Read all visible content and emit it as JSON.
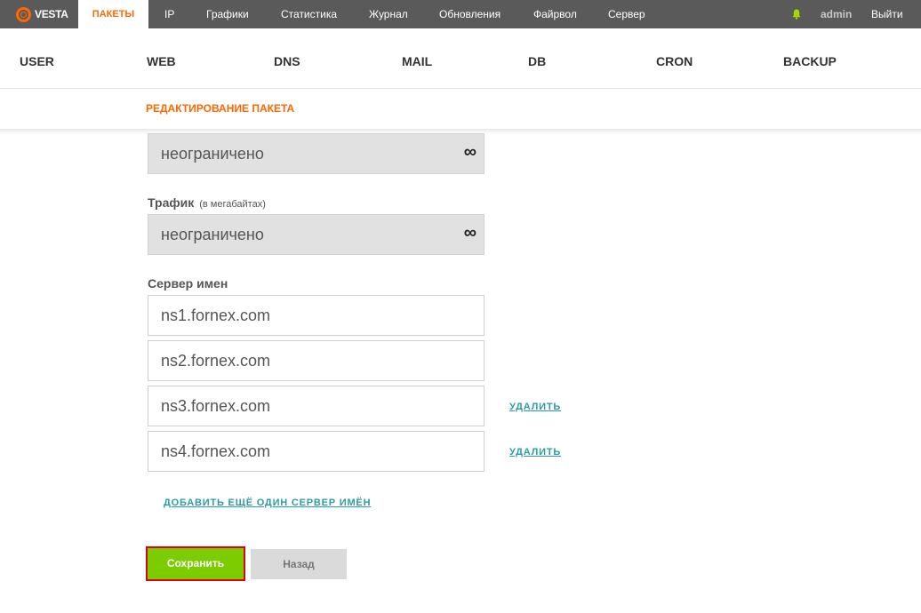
{
  "app": {
    "logo_text": "VESTA"
  },
  "topnav": {
    "items": [
      {
        "label": "ПАКЕТЫ",
        "active": true
      },
      {
        "label": "IP"
      },
      {
        "label": "Графики"
      },
      {
        "label": "Статистика"
      },
      {
        "label": "Журнал"
      },
      {
        "label": "Обновления"
      },
      {
        "label": "Файрвол"
      },
      {
        "label": "Сервер"
      }
    ],
    "user": "admin",
    "logout": "Выйти",
    "bell_icon": "bell-icon"
  },
  "secnav": {
    "items": [
      "USER",
      "WEB",
      "DNS",
      "MAIL",
      "DB",
      "CRON",
      "BACKUP"
    ]
  },
  "subheader": {
    "title": "РЕДАКТИРОВАНИЕ ПАКЕТА"
  },
  "form": {
    "disk_quota": {
      "value": "неограничено",
      "icon": "infinity-icon"
    },
    "traffic": {
      "label": "Трафик",
      "hint": "(в мегабайтах)",
      "value": "неограничено",
      "icon": "infinity-icon"
    },
    "nameservers": {
      "label": "Сервер имен",
      "items": [
        {
          "value": "ns1.fornex.com"
        },
        {
          "value": "ns2.fornex.com"
        },
        {
          "value": "ns3.fornex.com",
          "delete_label": "УДАЛИТЬ"
        },
        {
          "value": "ns4.fornex.com",
          "delete_label": "УДАЛИТЬ"
        }
      ],
      "add_label": "ДОБАВИТЬ ЕЩЁ ОДИН СЕРВЕР ИМЁН"
    },
    "save_label": "Сохранить",
    "back_label": "Назад"
  },
  "colors": {
    "accent": "#ff6701",
    "save": "#7dcc00",
    "link": "#2c9ca6",
    "topbar": "#5a5a5a"
  }
}
